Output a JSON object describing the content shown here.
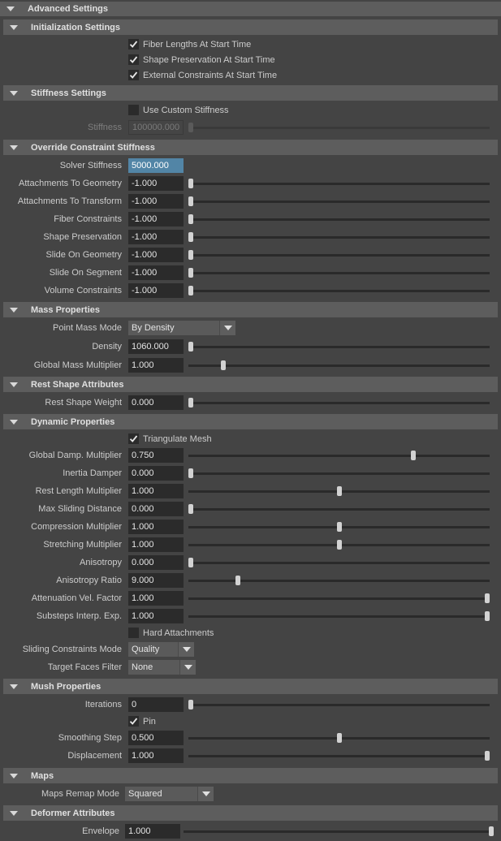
{
  "sections": {
    "advanced": "Advanced Settings",
    "initialization": "Initialization Settings",
    "stiffness": "Stiffness Settings",
    "override": "Override Constraint Stiffness",
    "mass": "Mass Properties",
    "rest": "Rest Shape Attributes",
    "dynamic": "Dynamic Properties",
    "mush": "Mush Properties",
    "maps": "Maps",
    "deformer": "Deformer Attributes"
  },
  "init": {
    "fiber_lengths": "Fiber Lengths At Start Time",
    "shape_preservation": "Shape Preservation At Start Time",
    "external_constraints": "External Constraints At Start Time"
  },
  "stiffness": {
    "use_custom": "Use Custom Stiffness",
    "stiffness_label": "Stiffness",
    "stiffness_value": "100000.000",
    "stiffness_slider": 0
  },
  "override": {
    "solver_label": "Solver Stiffness",
    "solver_value": "5000.000",
    "attach_geo_label": "Attachments To Geometry",
    "attach_geo_value": "-1.000",
    "attach_geo_slider": 0,
    "attach_xf_label": "Attachments To Transform",
    "attach_xf_value": "-1.000",
    "attach_xf_slider": 0,
    "fiber_label": "Fiber Constraints",
    "fiber_value": "-1.000",
    "fiber_slider": 0,
    "shape_label": "Shape Preservation",
    "shape_value": "-1.000",
    "shape_slider": 0,
    "slide_geo_label": "Slide On Geometry",
    "slide_geo_value": "-1.000",
    "slide_geo_slider": 0,
    "slide_seg_label": "Slide On Segment",
    "slide_seg_value": "-1.000",
    "slide_seg_slider": 0,
    "volume_label": "Volume Constraints",
    "volume_value": "-1.000",
    "volume_slider": 0
  },
  "mass": {
    "mode_label": "Point Mass Mode",
    "mode_value": "By Density",
    "density_label": "Density",
    "density_value": "1060.000",
    "density_slider": 0,
    "global_label": "Global Mass Multiplier",
    "global_value": "1.000",
    "global_slider": 0.11
  },
  "rest": {
    "weight_label": "Rest Shape Weight",
    "weight_value": "0.000",
    "weight_slider": 0
  },
  "dynamic": {
    "triangulate": "Triangulate Mesh",
    "damp_label": "Global Damp. Multiplier",
    "damp_value": "0.750",
    "damp_slider": 0.75,
    "inertia_label": "Inertia Damper",
    "inertia_value": "0.000",
    "inertia_slider": 0,
    "restlen_label": "Rest Length Multiplier",
    "restlen_value": "1.000",
    "restlen_slider": 0.5,
    "maxslide_label": "Max Sliding Distance",
    "maxslide_value": "0.000",
    "maxslide_slider": 0,
    "compress_label": "Compression Multiplier",
    "compress_value": "1.000",
    "compress_slider": 0.5,
    "stretch_label": "Stretching Multiplier",
    "stretch_value": "1.000",
    "stretch_slider": 0.5,
    "aniso_label": "Anisotropy",
    "aniso_value": "0.000",
    "aniso_slider": 0,
    "aniso_ratio_label": "Anisotropy Ratio",
    "aniso_ratio_value": "9.000",
    "aniso_ratio_slider": 0.16,
    "atten_label": "Attenuation Vel. Factor",
    "atten_value": "1.000",
    "atten_slider": 1,
    "substeps_label": "Substeps Interp. Exp.",
    "substeps_value": "1.000",
    "substeps_slider": 1,
    "hard_attach": "Hard Attachments",
    "sliding_mode_label": "Sliding Constraints Mode",
    "sliding_mode_value": "Quality",
    "target_faces_label": "Target Faces Filter",
    "target_faces_value": "None"
  },
  "mush": {
    "iter_label": "Iterations",
    "iter_value": "0",
    "iter_slider": 0,
    "pin": "Pin",
    "smooth_label": "Smoothing Step",
    "smooth_value": "0.500",
    "smooth_slider": 0.5,
    "disp_label": "Displacement",
    "disp_value": "1.000",
    "disp_slider": 1
  },
  "maps": {
    "remap_label": "Maps Remap Mode",
    "remap_value": "Squared"
  },
  "deformer": {
    "envelope_label": "Envelope",
    "envelope_value": "1.000",
    "envelope_slider": 1
  },
  "colors": {
    "panel_bg": "#444444",
    "header_bg": "#5d5d5d",
    "field_bg": "#2b2b2b",
    "highlight": "#5285a6"
  }
}
